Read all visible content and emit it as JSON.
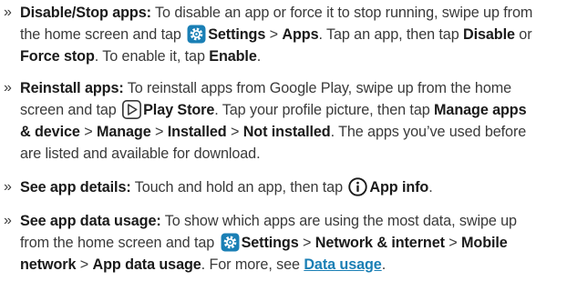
{
  "items": [
    {
      "bullet": "»",
      "title": "Disable/Stop apps:",
      "t1": " To disable an app or force it to stop running, swipe up from the home screen and tap ",
      "settings": "Settings",
      "t2": " > ",
      "apps": "Apps",
      "t3": ". Tap an app, then tap ",
      "disable": "Disable",
      "t4": " or ",
      "force_stop": "Force stop",
      "t5": ". To enable it, tap ",
      "enable": "Enable",
      "t6": "."
    },
    {
      "bullet": "»",
      "title": "Reinstall apps:",
      "t1": " To reinstall apps from Google Play, swipe up from the home screen and tap ",
      "play_store": "Play Store",
      "t2": ". Tap your profile picture, then tap ",
      "manage": "Manage apps & device",
      "t3": " > ",
      "manage2": "Manage",
      "t4": " > ",
      "installed": "Installed",
      "t5": " > ",
      "not_installed": "Not installed",
      "t6": ". The apps you’ve used before are listed and available for download."
    },
    {
      "bullet": "»",
      "title": "See app details:",
      "t1": " Touch and hold an app, then tap ",
      "app_info": "App info",
      "t2": "."
    },
    {
      "bullet": "»",
      "title": "See app data usage:",
      "t1": " To show which apps are using the most data, swipe up from the home screen and tap ",
      "settings": "Settings",
      "t2": " > ",
      "network": "Network & internet",
      "t3": " > ",
      "mobile": "Mobile network",
      "t4": " > ",
      "data_usage": "App data usage",
      "t5": ". For more, see ",
      "link": "Data usage",
      "t6": "."
    }
  ],
  "icons": {
    "settings_color": "#1a7fb5",
    "play_color": "#3a3a3a",
    "info_color": "#1a1a1a"
  }
}
